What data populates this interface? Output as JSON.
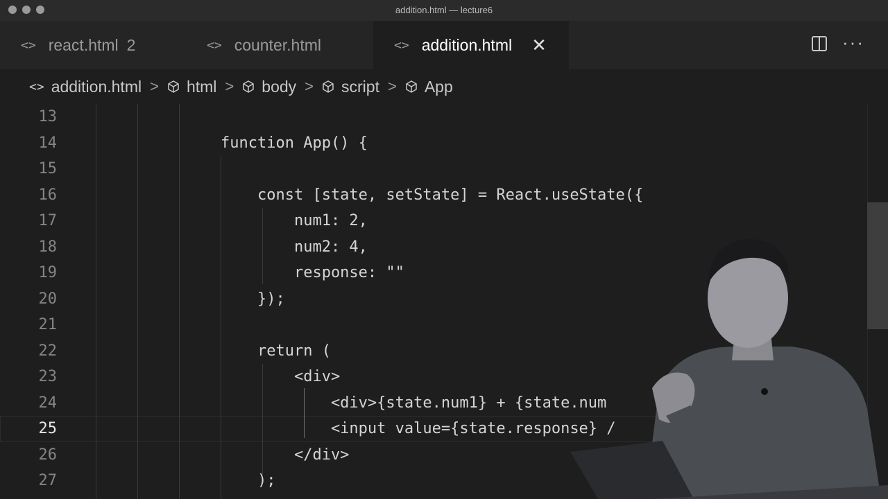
{
  "window": {
    "title": "addition.html — lecture6"
  },
  "tabs": [
    {
      "label": "react.html",
      "badge": "2",
      "icon": "code-brackets-icon"
    },
    {
      "label": "counter.html",
      "icon": "code-brackets-icon"
    },
    {
      "label": "addition.html",
      "icon": "code-brackets-icon",
      "active": true,
      "close": "✕"
    }
  ],
  "breadcrumb": {
    "items": [
      "addition.html",
      "html",
      "body",
      "script",
      "App"
    ],
    "separator": ">"
  },
  "editor": {
    "current_line": 25,
    "lines": [
      {
        "n": "13",
        "code": ""
      },
      {
        "n": "14",
        "code": "function App() {"
      },
      {
        "n": "15",
        "code": ""
      },
      {
        "n": "16",
        "code": "    const [state, setState] = React.useState({"
      },
      {
        "n": "17",
        "code": "        num1: 2,"
      },
      {
        "n": "18",
        "code": "        num2: 4,"
      },
      {
        "n": "19",
        "code": "        response: \"\""
      },
      {
        "n": "20",
        "code": "    });"
      },
      {
        "n": "21",
        "code": ""
      },
      {
        "n": "22",
        "code": "    return ("
      },
      {
        "n": "23",
        "code": "        <div>"
      },
      {
        "n": "24",
        "code": "            <div>{state.num1} + {state.num"
      },
      {
        "n": "25",
        "code": "            <input value={state.response} /"
      },
      {
        "n": "26",
        "code": "        </div>"
      },
      {
        "n": "27",
        "code": "    );"
      }
    ]
  },
  "icons": {
    "split": "split-editor-icon",
    "more": "more-actions-icon",
    "symbol": "cube-symbol-icon"
  },
  "colors": {
    "background": "#1e1e1e",
    "tabbar": "#252526",
    "text": "#d4d4d4",
    "line_number": "#858585"
  }
}
